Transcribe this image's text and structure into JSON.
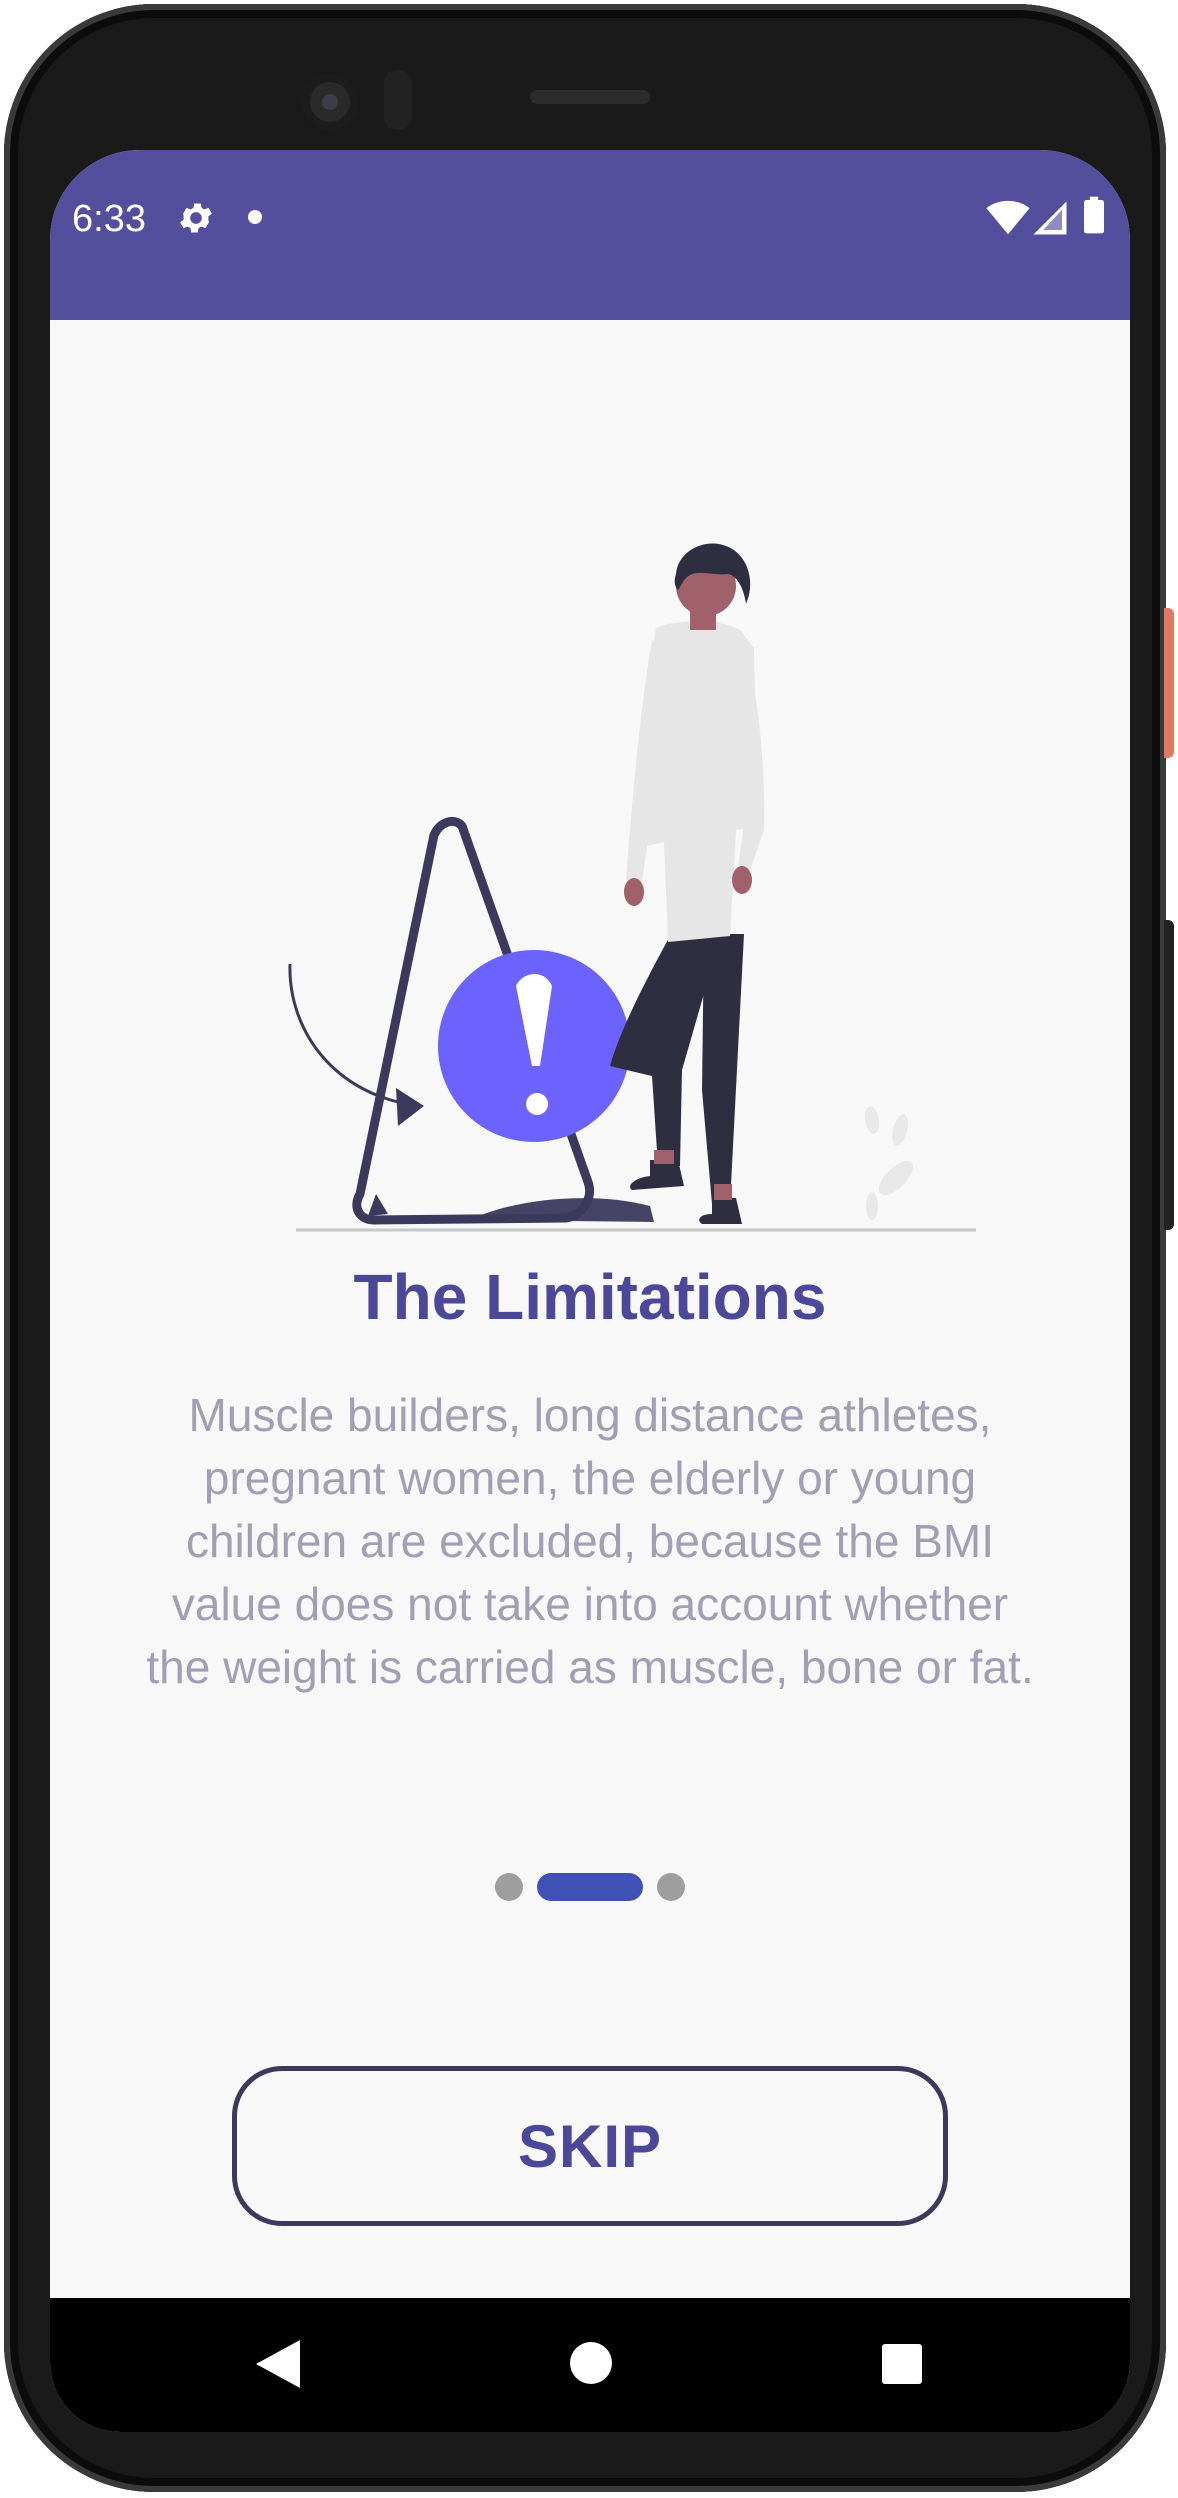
{
  "status_bar": {
    "time": "6:33",
    "background_color": "#544f9d",
    "icons": [
      "gear-icon",
      "notification-dot-icon",
      "wifi-icon",
      "cell-signal-icon",
      "battery-icon"
    ]
  },
  "onboarding": {
    "illustration": "person-with-warning-sign-illustration",
    "title": "The Limitations",
    "description": "Muscle builders, long distance athletes, pregnant women, the elderly or young children are excluded, because the BMI value does not take into account whether the weight is carried as muscle, bone or fat.",
    "page_indicator": {
      "total_pages": 3,
      "current_page": 2
    },
    "skip_label": "SKIP",
    "accent_color": "#4b489a",
    "indicator_active_color": "#3f51b5",
    "warning_circle_color": "#6c63ff"
  },
  "nav_bar": {
    "icons": [
      "back-icon",
      "home-icon",
      "recents-icon"
    ]
  }
}
